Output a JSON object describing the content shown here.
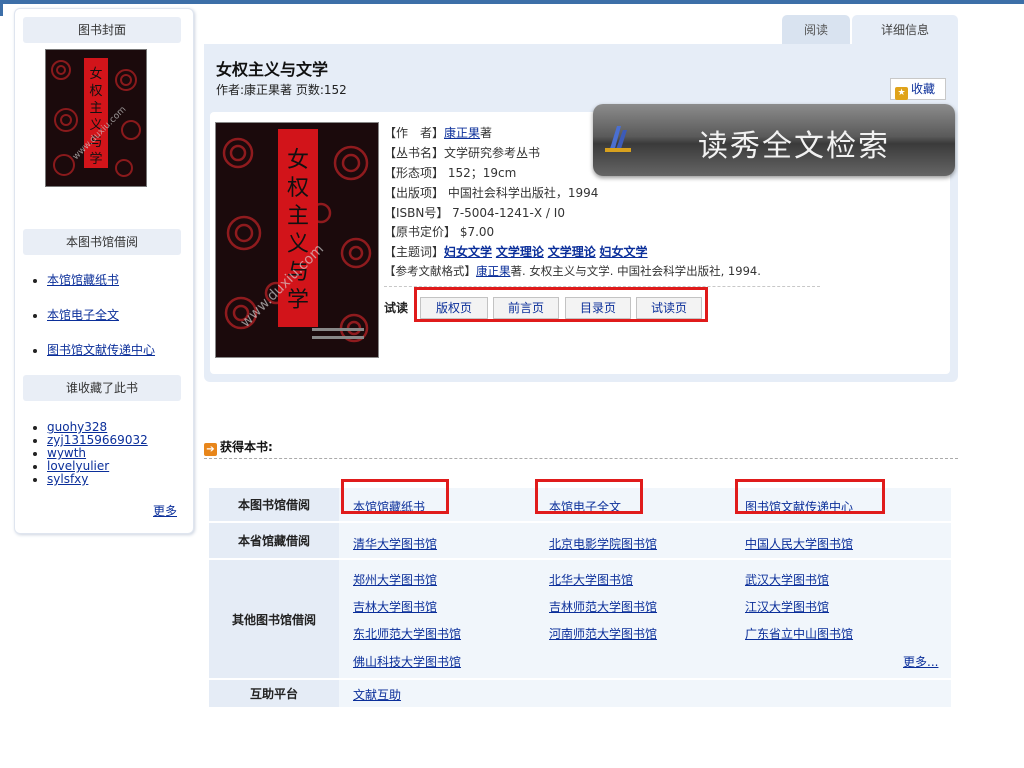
{
  "sidebar": {
    "cover_title": "图书封面",
    "library_title": "本图书馆借阅",
    "library_links": [
      "本馆馆藏纸书",
      "本馆电子全文",
      "图书馆文献传递中心"
    ],
    "favorites_title": "谁收藏了此书",
    "favorite_users": [
      "guohy328",
      "zyj13159669032",
      "wywth",
      "lovelyulier",
      "sylsfxy"
    ],
    "more": "更多"
  },
  "tabs": {
    "read": "阅读",
    "details": "详细信息"
  },
  "book": {
    "title": "女权主义与文学",
    "author_line": "作者:康正果著   页数:152",
    "favorite_button": "收藏",
    "cover_text": "女权主义与文学",
    "watermark": "www.duxiu.com",
    "meta": {
      "author_label": "【作　者】",
      "author_link": "康正果",
      "author_suffix": "著",
      "series": "【丛书名】文学研究参考丛书",
      "physical": "【形态项】 152；19cm",
      "publish": "【出版项】 中国社会科学出版社，1994",
      "isbn": "【ISBN号】 7-5004-1241-X / I0",
      "price": "【原书定价】 $7.00",
      "subject_label": "【主题词】",
      "subjects": [
        "妇女文学",
        "文学理论",
        "文学理论",
        "妇女文学"
      ],
      "ref_label": "【参考文献格式】",
      "ref_link": "康正果",
      "ref_rest": "著. 女权主义与文学. 中国社会科学出版社, 1994."
    },
    "try_read_label": "试读",
    "try_read_pages": [
      "版权页",
      "前言页",
      "目录页",
      "试读页"
    ]
  },
  "search_banner": "读秀全文检索",
  "get_book": {
    "heading": "获得本书:",
    "rows": {
      "library": {
        "label": "本图书馆借阅",
        "links": [
          "本馆馆藏纸书",
          "本馆电子全文",
          "图书馆文献传递中心"
        ]
      },
      "province": {
        "label": "本省馆藏借阅",
        "links": [
          "清华大学图书馆",
          "北京电影学院图书馆",
          "中国人民大学图书馆"
        ]
      },
      "other": {
        "label": "其他图书馆借阅",
        "links": [
          [
            "郑州大学图书馆",
            "北华大学图书馆",
            "武汉大学图书馆"
          ],
          [
            "吉林大学图书馆",
            "吉林师范大学图书馆",
            "江汉大学图书馆"
          ],
          [
            "东北师范大学图书馆",
            "河南师范大学图书馆",
            "广东省立中山图书馆"
          ],
          [
            "佛山科技大学图书馆"
          ]
        ],
        "more": "更多..."
      },
      "mutual": {
        "label": "互助平台",
        "links": [
          "文献互助"
        ]
      }
    }
  },
  "colors": {
    "highlight": "#e01b1b",
    "link": "#0b2f9a",
    "panel": "#e6edf7"
  }
}
